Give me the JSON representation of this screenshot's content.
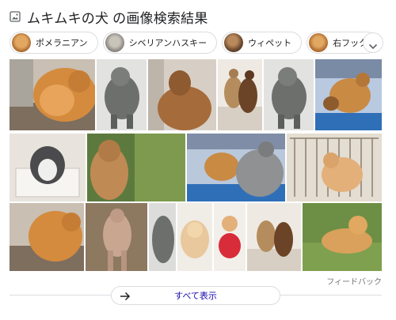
{
  "header": {
    "title": "ムキムキの犬 の画像検索結果",
    "icon": "image-icon"
  },
  "chips": [
    {
      "label": "ポメラニアン",
      "thumb_color": "#c98a4a"
    },
    {
      "label": "シベリアンハスキー",
      "thumb_color": "#8a8a88"
    },
    {
      "label": "ウィペット",
      "thumb_color": "#7a5a3c"
    },
    {
      "label": "右フック",
      "thumb_color": "#b9793e"
    }
  ],
  "chips_next_icon": "chevron-down-icon",
  "feedback": "フィードバック",
  "show_all": {
    "label": "すべて表示",
    "icon": "arrow-right-icon"
  },
  "colors": {
    "link": "#1a0dab",
    "border": "#dadce0",
    "muted": "#70757a"
  }
}
